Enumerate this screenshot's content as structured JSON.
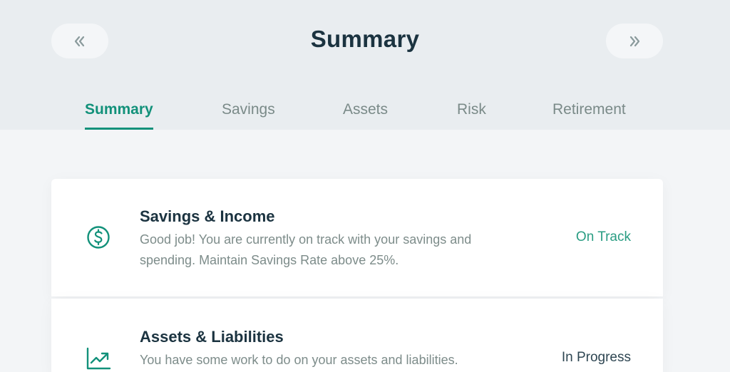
{
  "header": {
    "title": "Summary",
    "prev_button_icon": "double-chevron-left-icon",
    "next_button_icon": "double-chevron-right-icon"
  },
  "tabs": [
    {
      "label": "Summary",
      "active": true
    },
    {
      "label": "Savings",
      "active": false
    },
    {
      "label": "Assets",
      "active": false
    },
    {
      "label": "Risk",
      "active": false
    },
    {
      "label": "Retirement",
      "active": false
    }
  ],
  "summary_items": [
    {
      "icon": "dollar-circle-icon",
      "title": "Savings & Income",
      "description": "Good job! You are currently on track with your savings and spending. Maintain Savings Rate above 25%.",
      "status": "On Track",
      "status_color": "#2a9d83"
    },
    {
      "icon": "trending-up-chart-icon",
      "title": "Assets & Liabilities",
      "description": "You have some work to do on your assets and liabilities.",
      "status": "In Progress",
      "status_color": "#2e4652"
    }
  ],
  "colors": {
    "accent": "#12917a",
    "title_text": "#1b3340",
    "muted_text": "#7d8c8a",
    "header_bg": "#e9edf0",
    "page_bg": "#f3f5f7"
  }
}
